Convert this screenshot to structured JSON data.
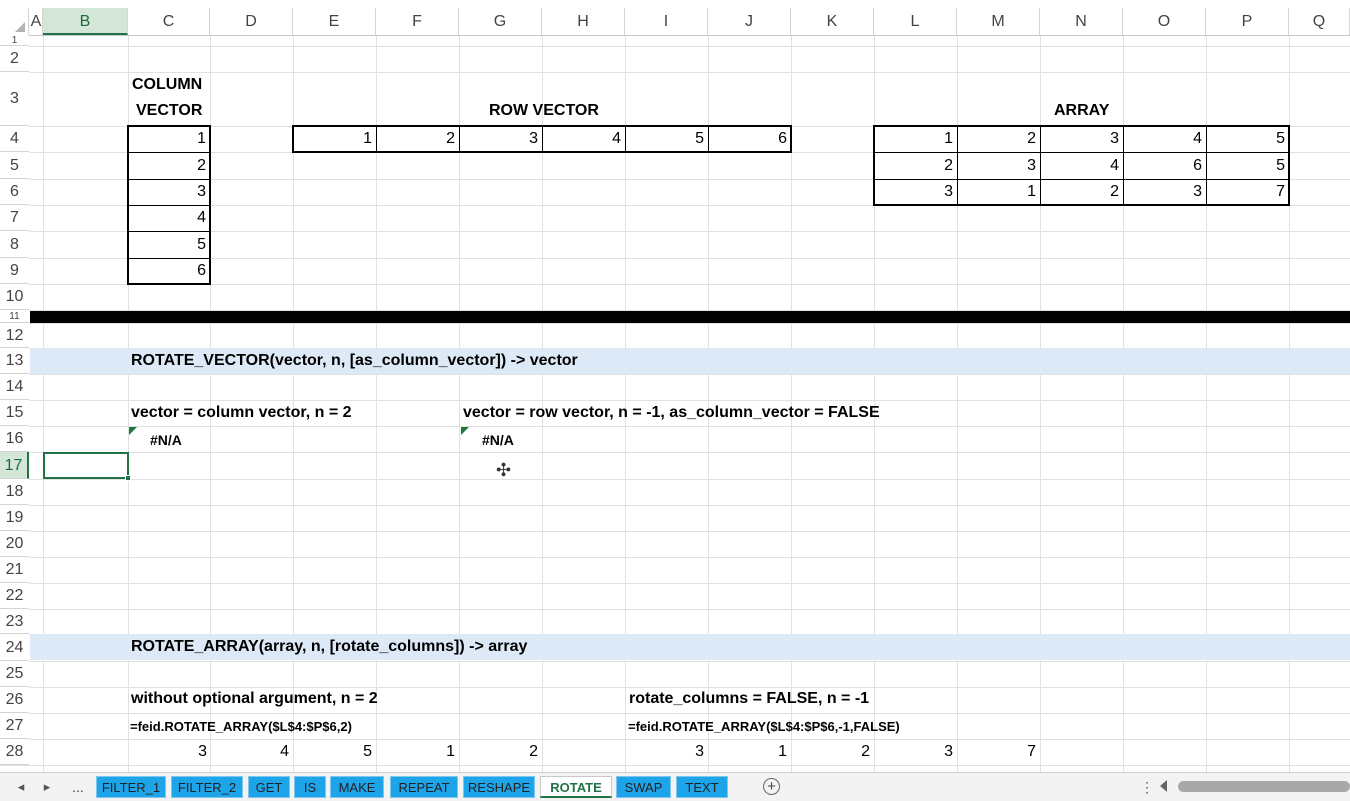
{
  "columns": [
    "A",
    "B",
    "C",
    "D",
    "E",
    "F",
    "G",
    "H",
    "I",
    "J",
    "K",
    "L",
    "M",
    "N",
    "O",
    "P",
    "Q"
  ],
  "selected_column": "B",
  "rows": [
    {
      "n": "1"
    },
    {
      "n": "2"
    },
    {
      "n": "3"
    },
    {
      "n": "4"
    },
    {
      "n": "5"
    },
    {
      "n": "6"
    },
    {
      "n": "7"
    },
    {
      "n": "8"
    },
    {
      "n": "9"
    },
    {
      "n": "10"
    },
    {
      "n": "11"
    },
    {
      "n": "12"
    },
    {
      "n": "13"
    },
    {
      "n": "14"
    },
    {
      "n": "15"
    },
    {
      "n": "16"
    },
    {
      "n": "17"
    },
    {
      "n": "18"
    },
    {
      "n": "19"
    },
    {
      "n": "20"
    },
    {
      "n": "21"
    },
    {
      "n": "22"
    },
    {
      "n": "23"
    },
    {
      "n": "24"
    },
    {
      "n": "25"
    },
    {
      "n": "26"
    },
    {
      "n": "27"
    },
    {
      "n": "28"
    }
  ],
  "selected_row": "17",
  "headers": {
    "column_vector_1": "COLUMN",
    "column_vector_2": "VECTOR",
    "row_vector": "ROW VECTOR",
    "array": "ARRAY"
  },
  "column_vector": [
    "1",
    "2",
    "3",
    "4",
    "5",
    "6"
  ],
  "row_vector": [
    "1",
    "2",
    "3",
    "4",
    "5",
    "6"
  ],
  "array": [
    [
      "1",
      "2",
      "3",
      "4",
      "5"
    ],
    [
      "2",
      "3",
      "4",
      "6",
      "5"
    ],
    [
      "3",
      "1",
      "2",
      "3",
      "7"
    ]
  ],
  "section_rotate_vector": "ROTATE_VECTOR(vector, n, [as_column_vector]) -> vector",
  "example1_label": "vector = column vector, n = 2",
  "example1_result": "#N/A",
  "example2_label": "vector = row vector, n = -1, as_column_vector = FALSE",
  "example2_result": "#N/A",
  "section_rotate_array": "ROTATE_ARRAY(array, n, [rotate_columns]) -> array",
  "example3_label": "without optional argument, n = 2",
  "example3_formula": "=feid.ROTATE_ARRAY($L$4:$P$6,2)",
  "example3_values": [
    "3",
    "4",
    "5",
    "1",
    "2"
  ],
  "example4_label": "rotate_columns = FALSE, n = -1",
  "example4_formula": "=feid.ROTATE_ARRAY($L$4:$P$6,-1,FALSE)",
  "example4_values": [
    "3",
    "1",
    "2",
    "3",
    "7"
  ],
  "tabs": [
    "FILTER_1",
    "FILTER_2",
    "GET",
    "IS",
    "MAKE",
    "REPEAT",
    "RESHAPE",
    "ROTATE",
    "SWAP",
    "TEXT"
  ],
  "active_tab": "ROTATE",
  "nav": {
    "prev": "◂",
    "next": "▸",
    "more": "...",
    "add": "+",
    "options": "⋮"
  },
  "colors": {
    "accent": "#217346",
    "tab": "#1ea4e9",
    "band": "#dde9f7"
  }
}
